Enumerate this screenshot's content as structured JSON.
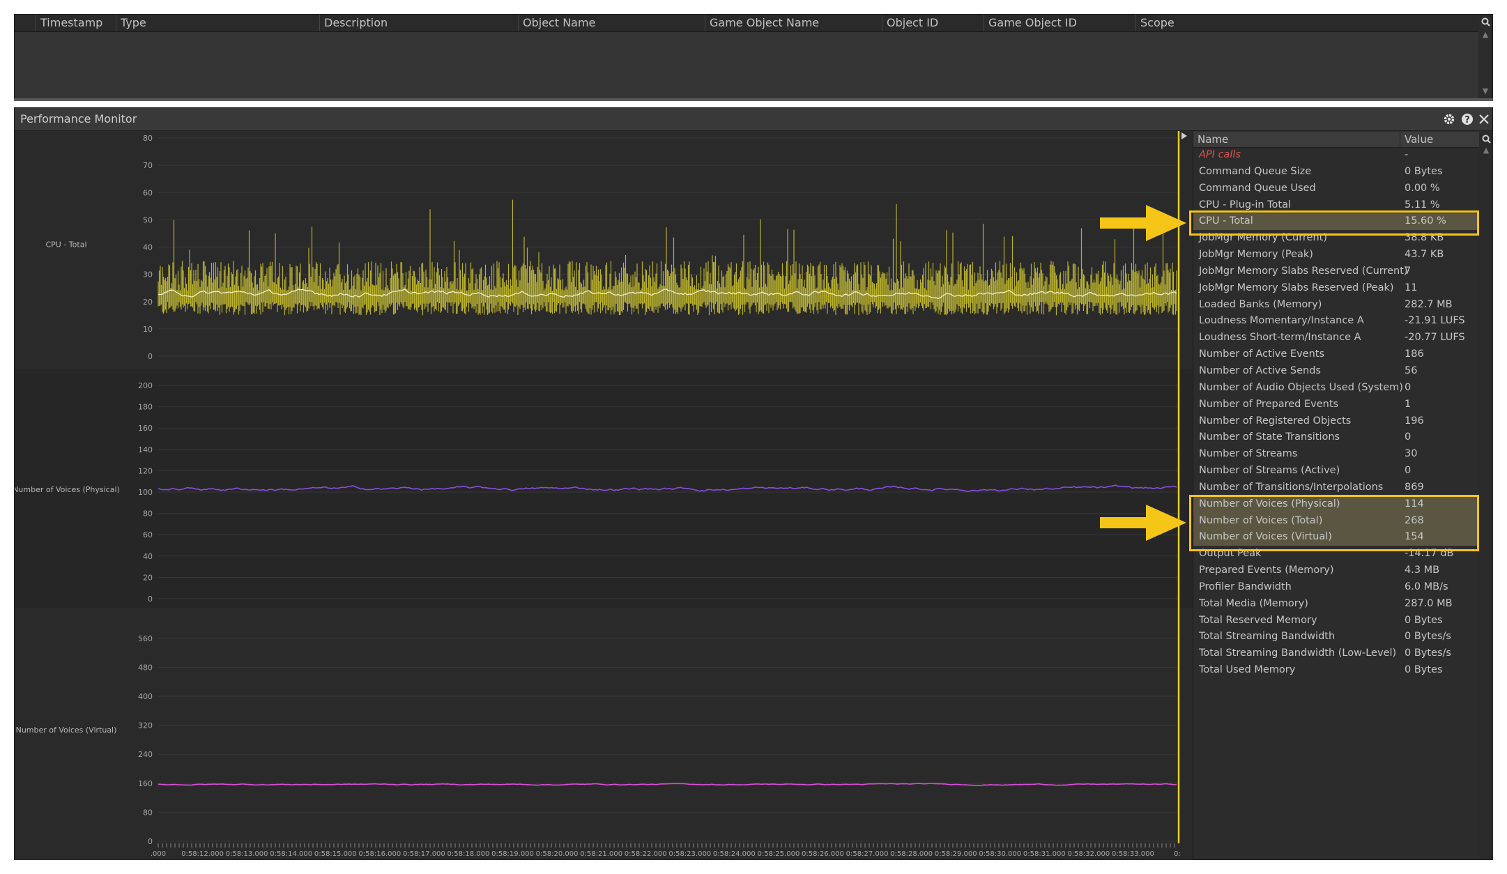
{
  "top_table": {
    "columns": [
      "Timestamp",
      "Type",
      "Description",
      "Object Name",
      "Game Object Name",
      "Object ID",
      "Game Object ID",
      "Scope"
    ],
    "search_icon": "search-icon"
  },
  "performance_monitor": {
    "title": "Performance Monitor",
    "icons": [
      "gear-icon",
      "help-icon",
      "close-icon"
    ]
  },
  "chart_data": [
    {
      "type": "line",
      "ylabel": "CPU - Total",
      "ylim": [
        0,
        80
      ],
      "yticks": [
        "80",
        "70",
        "60",
        "50",
        "40",
        "30",
        "20",
        "10",
        "0"
      ],
      "series": [
        {
          "color": "#b8b030",
          "min": 15,
          "typical_max": 35,
          "spike_max": 62
        },
        {
          "color": "#f2efc7",
          "mean": 23
        }
      ]
    },
    {
      "type": "line",
      "ylabel": "Number of Voices (Physical)",
      "ylim": [
        0,
        200
      ],
      "yticks": [
        "200",
        "180",
        "160",
        "140",
        "120",
        "100",
        "80",
        "60",
        "40",
        "20",
        "0"
      ],
      "series": [
        {
          "color": "#8a4de0",
          "mean": 103,
          "range": [
            98,
            108
          ]
        }
      ]
    },
    {
      "type": "line",
      "ylabel": "Number of Voices (Virtual)",
      "ylim": [
        0,
        600
      ],
      "yticks": [
        "560",
        "480",
        "400",
        "320",
        "240",
        "160",
        "80",
        "0"
      ],
      "series": [
        {
          "color": "#d44fd4",
          "mean": 157,
          "range": [
            152,
            164
          ]
        }
      ]
    }
  ],
  "time_axis": {
    "labels": [
      ".000",
      "0:58:12.000",
      "0:58:13.000",
      "0:58:14.000",
      "0:58:15.000",
      "0:58:16.000",
      "0:58:17.000",
      "0:58:18.000",
      "0:58:19.000",
      "0:58:20.000",
      "0:58:21.000",
      "0:58:22.000",
      "0:58:23.000",
      "0:58:24.000",
      "0:58:25.000",
      "0:58:26.000",
      "0:58:27.000",
      "0:58:28.000",
      "0:58:29.000",
      "0:58:30.000",
      "0:58:31.000",
      "0:58:32.000",
      "0:58:33.000",
      "0:"
    ]
  },
  "stats": {
    "columns": {
      "name": "Name",
      "value": "Value"
    },
    "rows": [
      {
        "name": "API calls",
        "value": "-",
        "api": true
      },
      {
        "name": "Command Queue Size",
        "value": "0 Bytes"
      },
      {
        "name": "Command Queue Used",
        "value": "0.00 %"
      },
      {
        "name": "CPU - Plug-in Total",
        "value": "5.11 %"
      },
      {
        "name": "CPU - Total",
        "value": "15.60 %",
        "highlight": true
      },
      {
        "name": "JobMgr Memory (Current)",
        "value": "38.8 KB"
      },
      {
        "name": "JobMgr Memory (Peak)",
        "value": "43.7 KB"
      },
      {
        "name": "JobMgr Memory Slabs Reserved (Current)",
        "value": "7"
      },
      {
        "name": "JobMgr Memory Slabs Reserved (Peak)",
        "value": "11"
      },
      {
        "name": "Loaded Banks (Memory)",
        "value": "282.7 MB"
      },
      {
        "name": "Loudness Momentary/Instance A",
        "value": "-21.91 LUFS"
      },
      {
        "name": "Loudness Short-term/Instance A",
        "value": "-20.77 LUFS"
      },
      {
        "name": "Number of Active Events",
        "value": "186"
      },
      {
        "name": "Number of Active Sends",
        "value": "56"
      },
      {
        "name": "Number of Audio Objects Used (System)",
        "value": "0"
      },
      {
        "name": "Number of Prepared Events",
        "value": "1"
      },
      {
        "name": "Number of Registered Objects",
        "value": "196"
      },
      {
        "name": "Number of State Transitions",
        "value": "0"
      },
      {
        "name": "Number of Streams",
        "value": "30"
      },
      {
        "name": "Number of Streams (Active)",
        "value": "0"
      },
      {
        "name": "Number of Transitions/Interpolations",
        "value": "869"
      },
      {
        "name": "Number of Voices (Physical)",
        "value": "114",
        "highlight": true
      },
      {
        "name": "Number of Voices (Total)",
        "value": "268",
        "highlight": true
      },
      {
        "name": "Number of Voices (Virtual)",
        "value": "154",
        "highlight": true
      },
      {
        "name": "Output Peak",
        "value": "-14.17 dB"
      },
      {
        "name": "Prepared Events (Memory)",
        "value": "4.3 MB"
      },
      {
        "name": "Profiler Bandwidth",
        "value": "6.0 MB/s"
      },
      {
        "name": "Total Media (Memory)",
        "value": "287.0 MB"
      },
      {
        "name": "Total Reserved Memory",
        "value": "0 Bytes"
      },
      {
        "name": "Total Streaming Bandwidth",
        "value": "0 Bytes/s"
      },
      {
        "name": "Total Streaming Bandwidth (Low-Level)",
        "value": "0 Bytes/s"
      },
      {
        "name": "Total Used Memory",
        "value": "0 Bytes"
      }
    ]
  },
  "colors": {
    "annotation": "#f5c518",
    "cursor": "#e6d21e"
  }
}
